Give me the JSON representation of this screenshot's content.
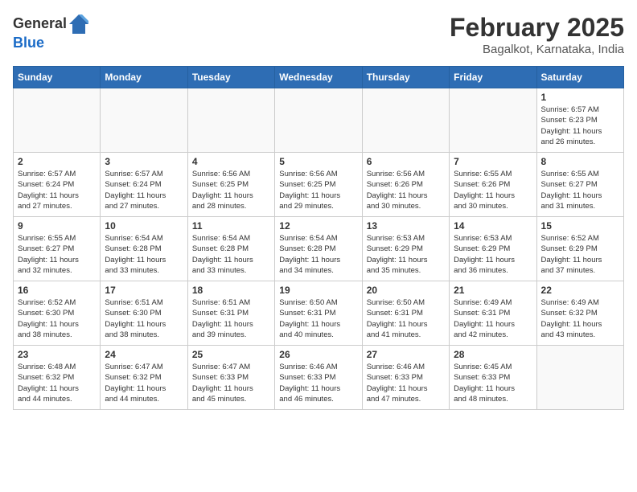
{
  "header": {
    "logo_line1": "General",
    "logo_line2": "Blue",
    "month_title": "February 2025",
    "location": "Bagalkot, Karnataka, India"
  },
  "days_of_week": [
    "Sunday",
    "Monday",
    "Tuesday",
    "Wednesday",
    "Thursday",
    "Friday",
    "Saturday"
  ],
  "weeks": [
    [
      {
        "day": "",
        "info": ""
      },
      {
        "day": "",
        "info": ""
      },
      {
        "day": "",
        "info": ""
      },
      {
        "day": "",
        "info": ""
      },
      {
        "day": "",
        "info": ""
      },
      {
        "day": "",
        "info": ""
      },
      {
        "day": "1",
        "info": "Sunrise: 6:57 AM\nSunset: 6:23 PM\nDaylight: 11 hours\nand 26 minutes."
      }
    ],
    [
      {
        "day": "2",
        "info": "Sunrise: 6:57 AM\nSunset: 6:24 PM\nDaylight: 11 hours\nand 27 minutes."
      },
      {
        "day": "3",
        "info": "Sunrise: 6:57 AM\nSunset: 6:24 PM\nDaylight: 11 hours\nand 27 minutes."
      },
      {
        "day": "4",
        "info": "Sunrise: 6:56 AM\nSunset: 6:25 PM\nDaylight: 11 hours\nand 28 minutes."
      },
      {
        "day": "5",
        "info": "Sunrise: 6:56 AM\nSunset: 6:25 PM\nDaylight: 11 hours\nand 29 minutes."
      },
      {
        "day": "6",
        "info": "Sunrise: 6:56 AM\nSunset: 6:26 PM\nDaylight: 11 hours\nand 30 minutes."
      },
      {
        "day": "7",
        "info": "Sunrise: 6:55 AM\nSunset: 6:26 PM\nDaylight: 11 hours\nand 30 minutes."
      },
      {
        "day": "8",
        "info": "Sunrise: 6:55 AM\nSunset: 6:27 PM\nDaylight: 11 hours\nand 31 minutes."
      }
    ],
    [
      {
        "day": "9",
        "info": "Sunrise: 6:55 AM\nSunset: 6:27 PM\nDaylight: 11 hours\nand 32 minutes."
      },
      {
        "day": "10",
        "info": "Sunrise: 6:54 AM\nSunset: 6:28 PM\nDaylight: 11 hours\nand 33 minutes."
      },
      {
        "day": "11",
        "info": "Sunrise: 6:54 AM\nSunset: 6:28 PM\nDaylight: 11 hours\nand 33 minutes."
      },
      {
        "day": "12",
        "info": "Sunrise: 6:54 AM\nSunset: 6:28 PM\nDaylight: 11 hours\nand 34 minutes."
      },
      {
        "day": "13",
        "info": "Sunrise: 6:53 AM\nSunset: 6:29 PM\nDaylight: 11 hours\nand 35 minutes."
      },
      {
        "day": "14",
        "info": "Sunrise: 6:53 AM\nSunset: 6:29 PM\nDaylight: 11 hours\nand 36 minutes."
      },
      {
        "day": "15",
        "info": "Sunrise: 6:52 AM\nSunset: 6:29 PM\nDaylight: 11 hours\nand 37 minutes."
      }
    ],
    [
      {
        "day": "16",
        "info": "Sunrise: 6:52 AM\nSunset: 6:30 PM\nDaylight: 11 hours\nand 38 minutes."
      },
      {
        "day": "17",
        "info": "Sunrise: 6:51 AM\nSunset: 6:30 PM\nDaylight: 11 hours\nand 38 minutes."
      },
      {
        "day": "18",
        "info": "Sunrise: 6:51 AM\nSunset: 6:31 PM\nDaylight: 11 hours\nand 39 minutes."
      },
      {
        "day": "19",
        "info": "Sunrise: 6:50 AM\nSunset: 6:31 PM\nDaylight: 11 hours\nand 40 minutes."
      },
      {
        "day": "20",
        "info": "Sunrise: 6:50 AM\nSunset: 6:31 PM\nDaylight: 11 hours\nand 41 minutes."
      },
      {
        "day": "21",
        "info": "Sunrise: 6:49 AM\nSunset: 6:31 PM\nDaylight: 11 hours\nand 42 minutes."
      },
      {
        "day": "22",
        "info": "Sunrise: 6:49 AM\nSunset: 6:32 PM\nDaylight: 11 hours\nand 43 minutes."
      }
    ],
    [
      {
        "day": "23",
        "info": "Sunrise: 6:48 AM\nSunset: 6:32 PM\nDaylight: 11 hours\nand 44 minutes."
      },
      {
        "day": "24",
        "info": "Sunrise: 6:47 AM\nSunset: 6:32 PM\nDaylight: 11 hours\nand 44 minutes."
      },
      {
        "day": "25",
        "info": "Sunrise: 6:47 AM\nSunset: 6:33 PM\nDaylight: 11 hours\nand 45 minutes."
      },
      {
        "day": "26",
        "info": "Sunrise: 6:46 AM\nSunset: 6:33 PM\nDaylight: 11 hours\nand 46 minutes."
      },
      {
        "day": "27",
        "info": "Sunrise: 6:46 AM\nSunset: 6:33 PM\nDaylight: 11 hours\nand 47 minutes."
      },
      {
        "day": "28",
        "info": "Sunrise: 6:45 AM\nSunset: 6:33 PM\nDaylight: 11 hours\nand 48 minutes."
      },
      {
        "day": "",
        "info": ""
      }
    ]
  ]
}
